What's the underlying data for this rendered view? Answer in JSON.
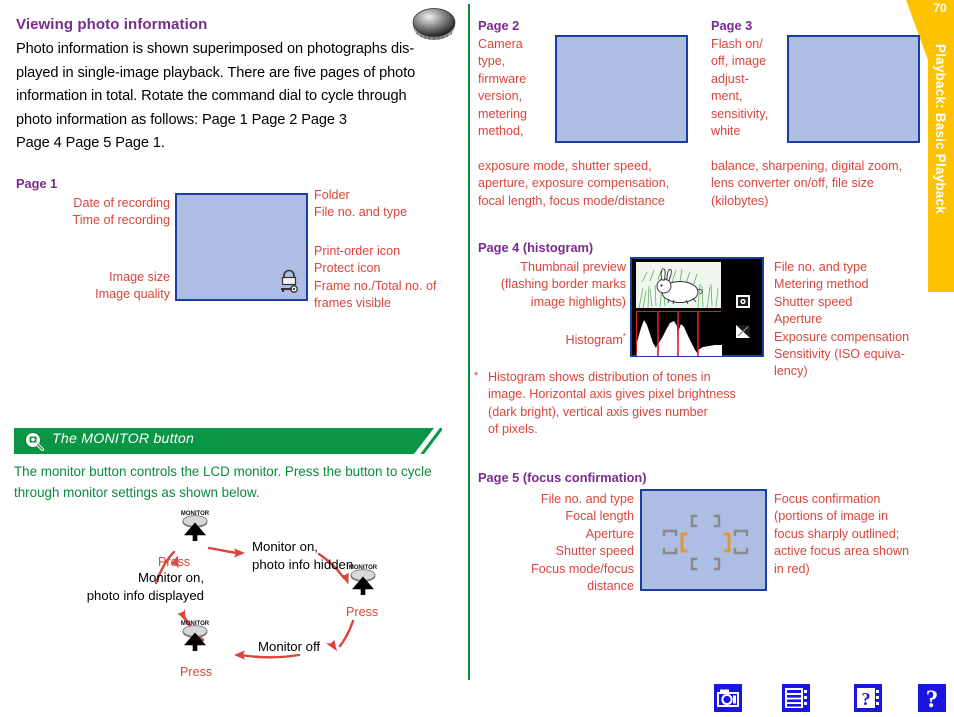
{
  "document": {
    "page_number": "70",
    "chapter_tab": "Playback: Basic Playback"
  },
  "intro": {
    "title": "Viewing photo information",
    "body": "Photo information is shown superimposed on photographs displayed in single-image playback.  There are five pages of photo information in total.  Rotate the command dial to cycle through photo information as follows: Page 1      Page 2      Page 3      Page 4      Page 5      Page 1.",
    "body_lines": [
      "Photo information is shown superimposed on photographs dis-",
      "played in single-image playback.  There are five pages of photo",
      "information in total.  Rotate the command dial to cycle through",
      "photo information as follows: Page 1        Page 2        Page 3",
      "Page 4       Page 5       Page 1."
    ],
    "dial_icon": "command-dial-icon"
  },
  "page1": {
    "heading": "Page 1",
    "left_labels": [
      "Date of recording",
      "Time of recording",
      "Image size",
      "Image quality"
    ],
    "right_labels": [
      "Folder",
      "File no. and type",
      "Print-order icon",
      "Protect icon",
      "Frame no./Total no. of",
      "frames visible"
    ],
    "screen_icon": "protect-key-icon"
  },
  "page2": {
    "heading": "Page 2",
    "side_lines": [
      "Camera",
      "type,",
      "firmware",
      "version,",
      "metering",
      "method,"
    ],
    "wide_lines": [
      "exposure mode, shutter speed,",
      "aperture, exposure compensation,",
      "focal length, focus mode/distance"
    ]
  },
  "page3": {
    "heading": "Page 3",
    "side_lines": [
      "Flash on/",
      "off, image",
      "adjust-",
      "ment,",
      "sensitivity,",
      "white"
    ],
    "wide_lines": [
      "balance, sharpening, digital zoom,",
      "lens converter on/off, file size",
      "(kilobytes)"
    ]
  },
  "page4": {
    "heading": "Page 4 (histogram)",
    "left_labels": [
      "Thumbnail preview",
      "(flashing border marks",
      "image highlights)",
      "Histogram"
    ],
    "histogram_marker": "*",
    "right_labels": [
      "File no. and type",
      "Metering method",
      "Shutter speed",
      "Aperture",
      "Exposure compensation",
      "Sensitivity (ISO equiva-",
      "lency)"
    ],
    "footnote_marker": "*",
    "footnote_lines": [
      "Histogram shows distribution of tones in",
      "image.  Horizontal axis gives pixel brightness",
      "(dark       bright), vertical axis gives number",
      "of pixels."
    ],
    "thumbnail_subject": "rabbit-illustration",
    "screen_icons": [
      "metering-method-icon",
      "exposure-compensation-icon"
    ]
  },
  "page5": {
    "heading": "Page 5 (focus confirmation)",
    "left_labels": [
      "File no. and type",
      "Focal length",
      "Aperture",
      "Shutter speed",
      "Focus mode/focus",
      "distance"
    ],
    "right_lines": [
      "Focus confirmation",
      "(portions of image in",
      "focus sharply outlined;",
      "active focus area shown",
      "in red)"
    ]
  },
  "tip": {
    "title": "The MONITOR button",
    "icon": "monitor-tip-icon",
    "body_lines": [
      "The monitor button controls the LCD monitor.  Press the button to cycle",
      "through monitor settings as shown below."
    ]
  },
  "cycle": {
    "button_caption": "MONITOR",
    "press_label": "Press",
    "states": [
      {
        "lines": [
          "Monitor on,",
          "photo info hidden"
        ]
      },
      {
        "lines": [
          "Monitor off"
        ]
      },
      {
        "lines": [
          "Monitor on,",
          "photo info displayed"
        ]
      }
    ]
  },
  "navbar": {
    "icons": [
      "camera-mode-icon",
      "menu-list-icon",
      "help-page-icon",
      "question-mark-icon"
    ]
  },
  "colors": {
    "heading_purple": "#7b2b8e",
    "label_red": "#d9453c",
    "tip_green": "#0a9644",
    "tab_yellow": "#fdc300",
    "lcd_blue": "#aebde4",
    "lcd_border": "#1940a0",
    "nav_blue": "#1a16e0"
  }
}
